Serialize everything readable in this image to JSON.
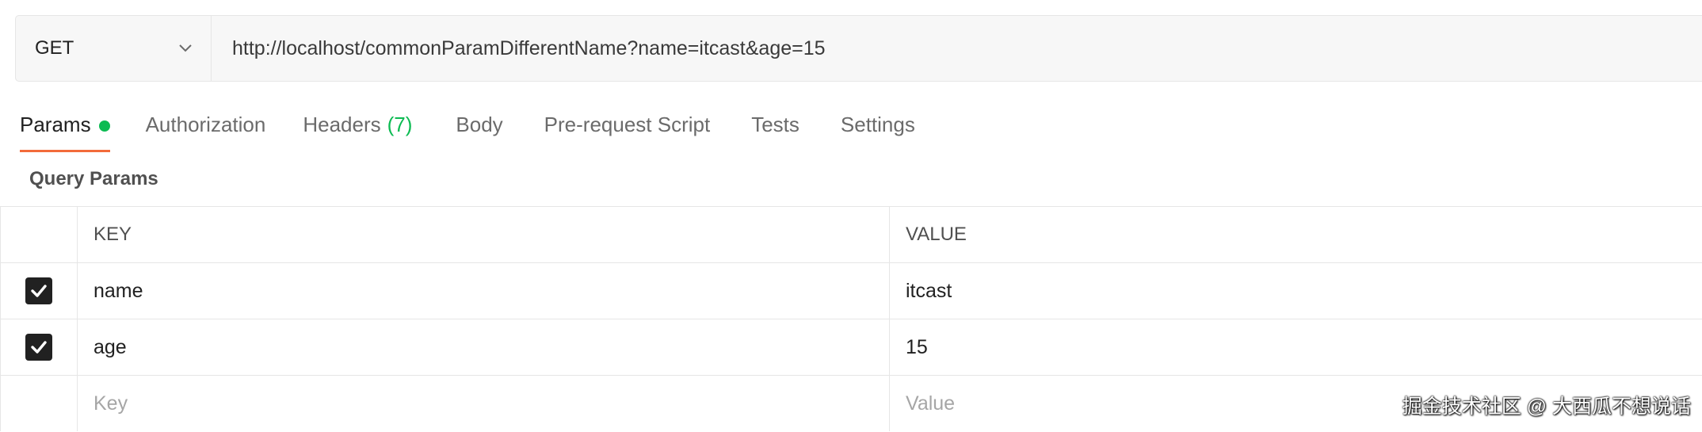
{
  "request": {
    "method": "GET",
    "url": "http://localhost/commonParamDifferentName?name=itcast&age=15"
  },
  "tabs": [
    {
      "label": "Params",
      "active": true,
      "has_dot": true
    },
    {
      "label": "Authorization"
    },
    {
      "label": "Headers",
      "count": "(7)"
    },
    {
      "label": "Body"
    },
    {
      "label": "Pre-request Script"
    },
    {
      "label": "Tests"
    },
    {
      "label": "Settings"
    }
  ],
  "query_params": {
    "title": "Query Params",
    "columns": {
      "key": "KEY",
      "value": "VALUE"
    },
    "rows": [
      {
        "key": "name",
        "value": "itcast",
        "checked": true
      },
      {
        "key": "age",
        "value": "15",
        "checked": true
      }
    ],
    "placeholder": {
      "key": "Key",
      "value": "Value"
    }
  },
  "watermark": "掘金技术社区 @ 大西瓜不想说话",
  "colors": {
    "accent": "#f26b3a",
    "success": "#0cbb52",
    "checkbox": "#212121"
  },
  "icons": {
    "method_dropdown": "chevron-down-icon",
    "row_check": "checkbox-checked-icon",
    "status_dot": "green-dot-icon"
  }
}
